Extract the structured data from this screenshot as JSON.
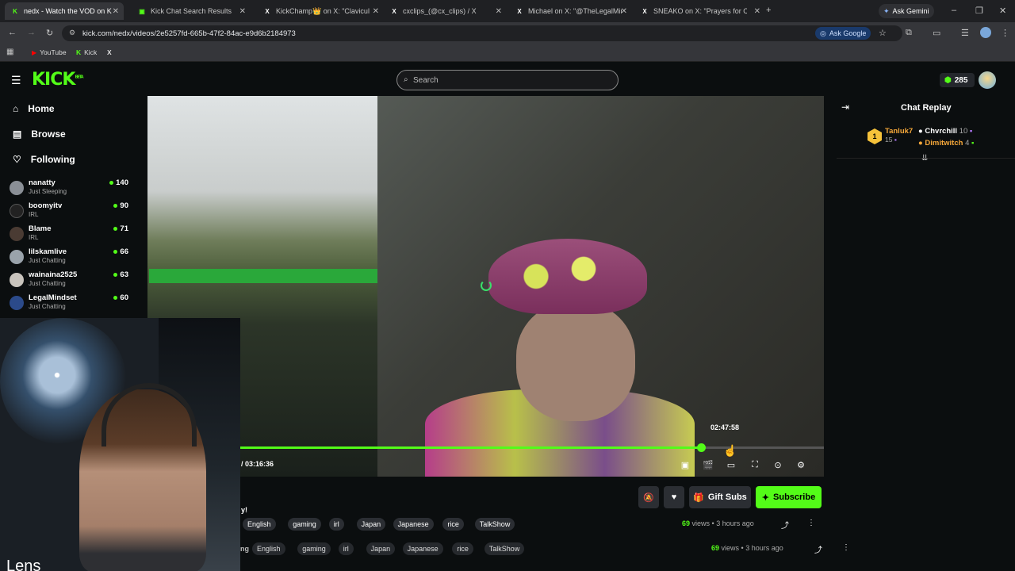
{
  "browser": {
    "tabs": [
      {
        "title": "nedx - Watch the VOD on K",
        "active": true,
        "fav": "K",
        "favcolor": "#53fc18"
      },
      {
        "title": "Kick Chat Search Results",
        "active": false,
        "fav": "▣",
        "favcolor": "#53fc18"
      },
      {
        "title": "KickChamp👑 on X: \"Claviculair",
        "active": false,
        "fav": "X",
        "favcolor": "#ffffff"
      },
      {
        "title": "cxclips_(@cx_clips) / X",
        "active": false,
        "fav": "X",
        "favcolor": "#ffffff"
      },
      {
        "title": "Michael on X: \"@TheLegalMind",
        "active": false,
        "fav": "X",
        "favcolor": "#ffffff"
      },
      {
        "title": "SNEAKO on X: \"Prayers for Cla",
        "active": false,
        "fav": "X",
        "favcolor": "#ffffff"
      }
    ],
    "new_tab": "+",
    "ask_gemini": "Ask Gemini",
    "url": "kick.com/nedx/videos/2e5257fd-665b-47f2-84ac-e9d6b2184973",
    "ask_google": "Ask Google",
    "bookmarks": [
      {
        "label": "YouTube",
        "color": "#ff0000",
        "icon": "▶"
      },
      {
        "label": "Kick",
        "color": "#53fc18",
        "icon": "K"
      },
      {
        "label": "",
        "color": "#ffffff",
        "icon": "X"
      }
    ]
  },
  "header": {
    "logo": "KICK",
    "logo_badge": "BETA",
    "search_placeholder": "Search",
    "points": "285"
  },
  "sidebar": {
    "nav": [
      {
        "label": "Home",
        "icon": "home-icon"
      },
      {
        "label": "Browse",
        "icon": "browse-icon"
      },
      {
        "label": "Following",
        "icon": "heart-icon"
      }
    ],
    "channels": [
      {
        "name": "nanatty",
        "category": "Just Sleeping",
        "viewers": "140"
      },
      {
        "name": "boomyitv",
        "category": "IRL",
        "viewers": "90"
      },
      {
        "name": "Blame",
        "category": "IRL",
        "viewers": "71"
      },
      {
        "name": "lilskamlive",
        "category": "Just Chatting",
        "viewers": "66"
      },
      {
        "name": "wainaina2525",
        "category": "Just Chatting",
        "viewers": "63"
      },
      {
        "name": "LegalMindset",
        "category": "Just Chatting",
        "viewers": "60"
      }
    ]
  },
  "player": {
    "hover_time": "02:47:58",
    "duration": "/ 03:16:36",
    "progress_fraction": 0.789
  },
  "chat": {
    "title": "Chat Replay",
    "leaders": [
      {
        "name": "Tanluk7",
        "count": "15",
        "color": "#f6a83a"
      },
      {
        "name": "Chvrchill",
        "count": "10",
        "color": "#ffffff"
      },
      {
        "name": "Dimitwitch",
        "count": "4",
        "color": "#f6a83a"
      }
    ]
  },
  "actions": {
    "gift_subs": "Gift Subs",
    "subscribe": "Subscribe"
  },
  "stream": {
    "title_fragment": "y!",
    "tags": [
      "English",
      "gaming",
      "irl",
      "Japan",
      "Japanese",
      "rice",
      "TalkShow"
    ],
    "views": "69",
    "views_label": "views",
    "age": "3 hours ago"
  },
  "ghost": {
    "prefix": "ng",
    "tags": [
      "English",
      "gaming",
      "irl",
      "Japan",
      "Japanese",
      "rice",
      "TalkShow"
    ],
    "views": "69",
    "views_label": "views",
    "age": "3 hours ago"
  },
  "webcam": {
    "caption": "Lens"
  }
}
